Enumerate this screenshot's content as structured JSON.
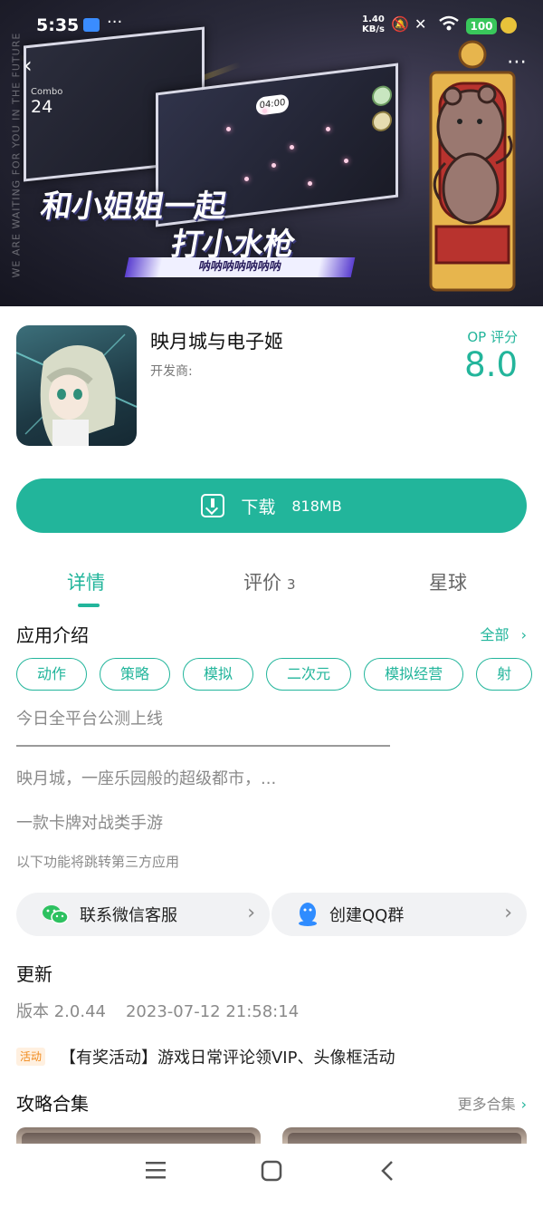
{
  "status_bar": {
    "time": "5:35",
    "dots": "···",
    "speed_value": "1.40",
    "speed_unit": "KB/s",
    "battery": "100"
  },
  "hero": {
    "combo_label": "Combo",
    "combo_value": "24",
    "slogan_line1": "和小姐姐一起",
    "slogan_line2": "打小水枪",
    "slogan_line3": "呐呐呐呐呐呐呐",
    "vertical_text": "WE ARE WAITING FOR YOU IN THE FUTURE",
    "timer": "04:00"
  },
  "app": {
    "name": "映月城与电子姬",
    "developer_label": "开发商:",
    "rating_label": "OP 评分",
    "rating_value": "8.0"
  },
  "download": {
    "label": "下载",
    "size": "818MB"
  },
  "tabs": [
    {
      "label": "详情",
      "count": ""
    },
    {
      "label": "评价",
      "count": "3"
    },
    {
      "label": "星球",
      "count": ""
    }
  ],
  "intro": {
    "title": "应用介绍",
    "all_link": "全部",
    "tags": [
      "动作",
      "策略",
      "模拟",
      "二次元",
      "模拟经营",
      "射"
    ],
    "headline": "今日全平台公测上线",
    "description": "映月城，一座乐园般的超级都市，...",
    "genre": "一款卡牌对战类手游",
    "third_party_note": "以下功能将跳转第三方应用"
  },
  "services": {
    "wechat_label": "联系微信客服",
    "qq_label": "创建QQ群"
  },
  "update": {
    "title": "更新",
    "version": "版本 2.0.44",
    "timestamp": "2023-07-12 21:58:14",
    "activity_badge": "活动",
    "activity_text": "【有奖活动】游戏日常评论领VIP、头像框活动"
  },
  "guides": {
    "title": "攻略合集",
    "more_link": "更多合集"
  },
  "colors": {
    "accent": "#22b59b",
    "badge_orange": "#f08a1c"
  }
}
